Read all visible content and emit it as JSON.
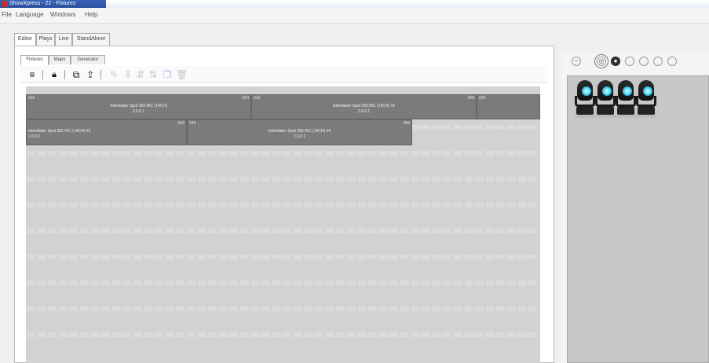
{
  "window": {
    "title": "ShowXpress - 22 - Fixtures"
  },
  "menu": {
    "items": [
      "File",
      "Language",
      "Windows",
      "Help"
    ]
  },
  "main_tabs": [
    {
      "label": "Editor",
      "active": true
    },
    {
      "label": "Plays",
      "active": false
    },
    {
      "label": "Live",
      "active": false
    },
    {
      "label": "StandAlone",
      "active": false
    }
  ],
  "editor_tabs": [
    {
      "label": "Fixtures",
      "active": true
    },
    {
      "label": "Maps",
      "active": false
    },
    {
      "label": "Generator",
      "active": false
    }
  ],
  "toolbar": {
    "icons": [
      "menu-icon",
      "lock-icon",
      "export-icon",
      "upload-icon",
      "edit-icon",
      "align-icon",
      "distribute-icon",
      "sort-icon",
      "copy-icon",
      "delete-icon"
    ]
  },
  "fixtures": [
    {
      "start": "001",
      "end": "014",
      "name": "Intimidator Spot 355 IRC (14CH)",
      "sub": "2.0.0.1"
    },
    {
      "start": "015",
      "end": "028",
      "name": "Intimidator Spot 355 IRC (14CH) #2",
      "sub": "2.0.0.1"
    },
    {
      "start": "029",
      "end": "042",
      "name": "Intimidator Spot 355 IRC (14CH) #3",
      "sub": "2.0.0.1"
    },
    {
      "start": "043",
      "end": "056",
      "name": "Intimidator Spot 355 IRC (14CH) #4",
      "sub": "2.0.0.1"
    }
  ],
  "right_panel": {
    "icons": [
      "circle-minus-icon",
      "target-icon",
      "filled-circle-icon",
      "circle-icon",
      "circle-icon-2",
      "circle-icon-3",
      "circle-icon-4"
    ],
    "fixture_count": 4
  },
  "colors": {
    "fixture_block": "#7b7b7b",
    "grid_bg": "#d2d2d2",
    "lens_accent": "#3fd1f5",
    "titlebar": "#2a4f9f"
  }
}
